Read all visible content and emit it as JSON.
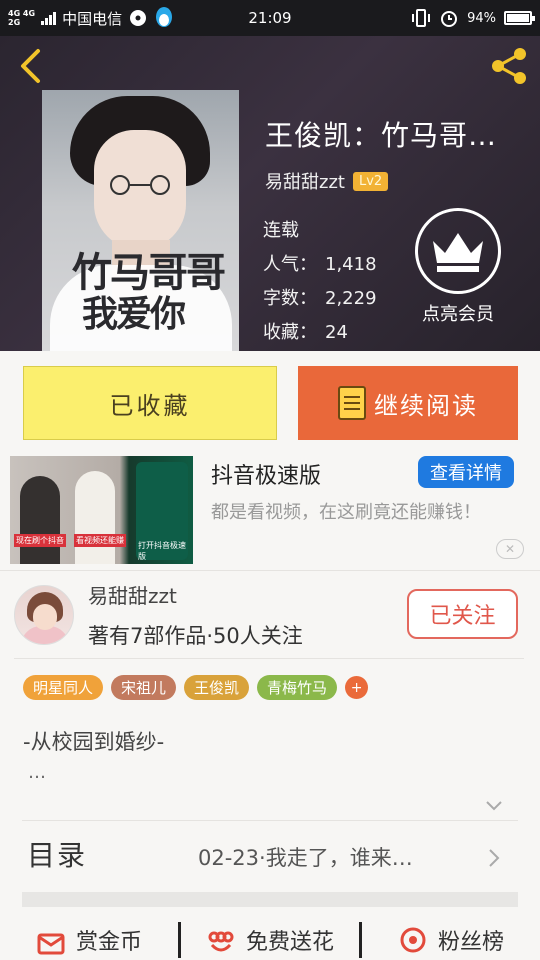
{
  "status_bar": {
    "network_top": "4G 4G",
    "network_bottom": "2G",
    "carrier": "中国电信",
    "time": "21:09",
    "battery": "94%"
  },
  "book": {
    "title": "王俊凯：竹马哥…",
    "author": "易甜甜zzt",
    "level": "Lv2",
    "status": "连载",
    "popularity_label": "人气：",
    "popularity_value": "1,418",
    "words_label": "字数：",
    "words_value": "2,229",
    "favorites_label": "收藏：",
    "favorites_value": "24",
    "cover_title_line1": "竹马哥哥",
    "cover_title_line2": "我爱你"
  },
  "vip": {
    "label": "点亮会员"
  },
  "actions": {
    "favorite_label": "已收藏",
    "read_label": "继续阅读"
  },
  "ad": {
    "title": "抖音极速版",
    "description": "都是看视频，在这刷竟还能赚钱！",
    "button_label": "查看详情",
    "close_label": "✕",
    "image_caption_1": "现在刷个抖音",
    "image_caption_2": "看视频还能赚",
    "image_caption_3": "打开抖音极速版"
  },
  "author_card": {
    "name": "易甜甜zzt",
    "stats": "著有7部作品·50人关注",
    "follow_label": "已关注"
  },
  "tags": [
    {
      "label": "明星同人",
      "color": "#f0a23a"
    },
    {
      "label": "宋祖儿",
      "color": "#c27a5e"
    },
    {
      "label": "王俊凯",
      "color": "#d9a23a"
    },
    {
      "label": "青梅竹马",
      "color": "#8bb84a"
    }
  ],
  "tag_add_label": "+",
  "intro": {
    "line1": "-从校园到婚纱-",
    "line2": "…"
  },
  "toc": {
    "label": "目录",
    "latest": "02-23·我走了，谁来…"
  },
  "bottom_actions": [
    {
      "label": "赏金币",
      "icon": "gift-envelope-icon"
    },
    {
      "label": "免费送花",
      "icon": "flower-icon"
    },
    {
      "label": "粉丝榜",
      "icon": "target-ranking-icon"
    }
  ],
  "colors": {
    "accent_orange": "#e9683a",
    "favorite_yellow": "#fbef6e",
    "level_badge": "#f2b234",
    "ad_button_blue": "#1f7ae0",
    "follow_red": "#e0574b"
  }
}
